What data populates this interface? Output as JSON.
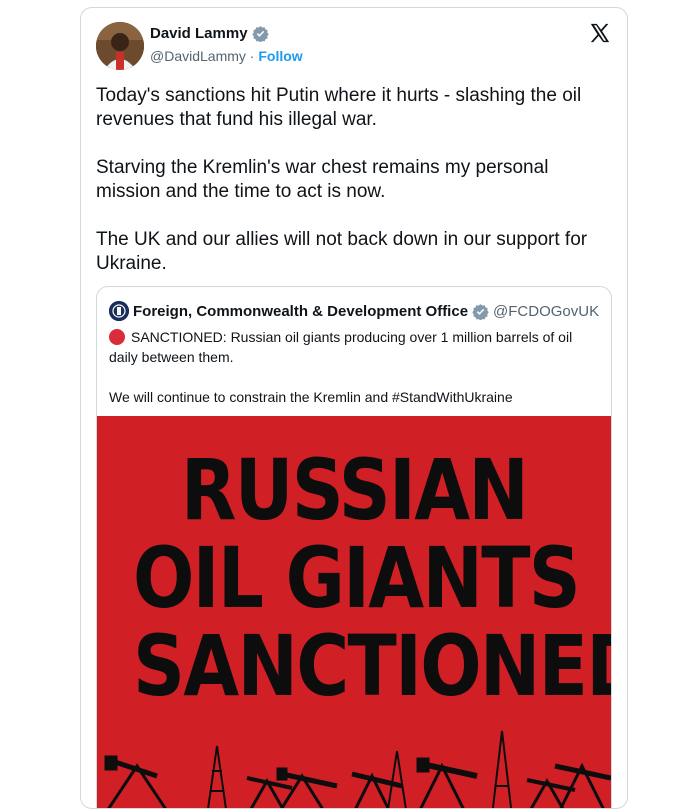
{
  "tweet": {
    "author_name": "David Lammy",
    "handle": "@DavidLammy",
    "separator": "·",
    "follow_label": "Follow",
    "paragraphs": [
      "Today's sanctions hit Putin where it hurts - slashing the oil revenues that fund his illegal war.",
      "Starving the Kremlin's war chest remains my personal mission and the time to act is now.",
      "The UK and our allies will not back down in our support for Ukraine."
    ]
  },
  "quote": {
    "author_name": "Foreign, Commonwealth & Development Office",
    "handle": "@FCDOGovUK",
    "line1": "SANCTIONED: Russian oil giants producing over 1 million barrels of oil daily between them.",
    "line2": "We will continue to constrain the Kremlin and #StandWithUkraine",
    "media_headline": [
      "RUSSIAN",
      "OIL GIANTS",
      "SANCTIONED"
    ]
  },
  "colors": {
    "accent": "#1d9bf0",
    "media_red": "#d11f26",
    "verified_blue": "#829aab"
  },
  "icons": [
    "verified-badge-icon",
    "x-logo-icon",
    "red-circle-icon"
  ]
}
